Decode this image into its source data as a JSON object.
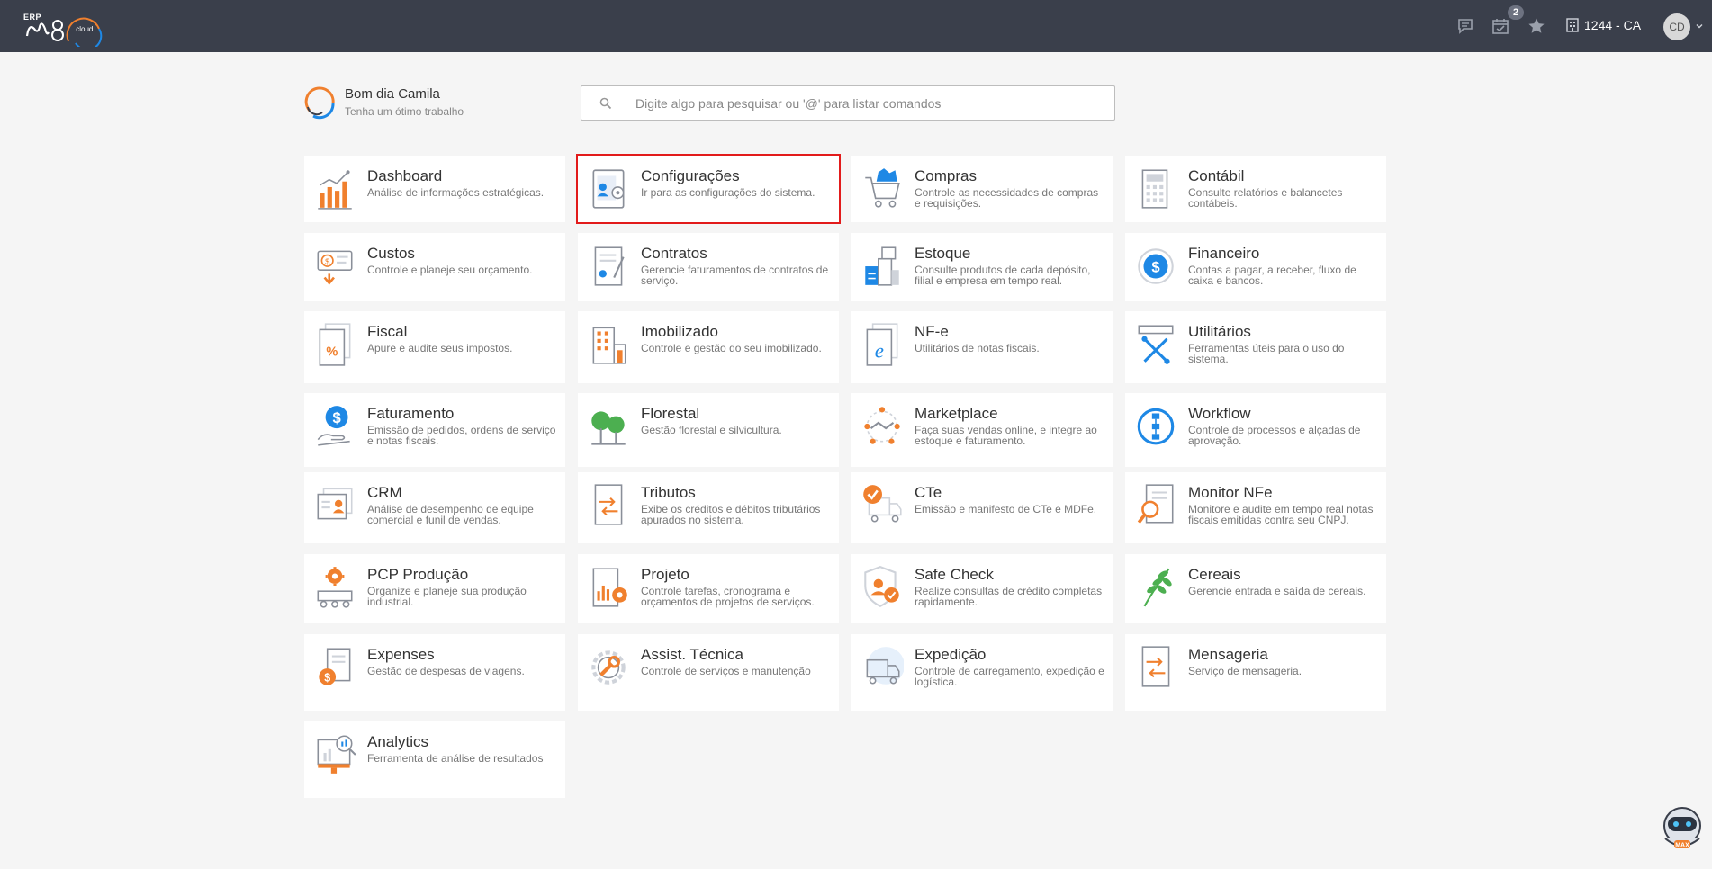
{
  "header": {
    "logo_small": "ERP",
    "notification_count": "2",
    "company": "1244 - CA",
    "avatar_initials": "CD"
  },
  "greeting": {
    "title": "Bom dia Camila",
    "subtitle": "Tenha um ótimo trabalho"
  },
  "search": {
    "placeholder": "Digite algo para pesquisar ou '@' para listar comandos"
  },
  "modules": [
    {
      "title": "Dashboard",
      "desc": "Análise de informações estratégicas.",
      "icon": "bar-chart-icon"
    },
    {
      "title": "Configurações",
      "desc": "Ir para as configurações do sistema.",
      "icon": "settings-tablet-icon"
    },
    {
      "title": "Compras",
      "desc": "Controle as necessidades de compras e requisições.",
      "icon": "shopping-cart-icon"
    },
    {
      "title": "Contábil",
      "desc": "Consulte relatórios e balancetes contábeis.",
      "icon": "calculator-icon"
    },
    {
      "title": "Custos",
      "desc": "Controle e planeje seu orçamento.",
      "icon": "money-bill-icon"
    },
    {
      "title": "Contratos",
      "desc": "Gerencie faturamentos de contratos de serviço.",
      "icon": "contract-icon"
    },
    {
      "title": "Estoque",
      "desc": "Consulte produtos de cada depósito, filial e empresa em tempo real.",
      "icon": "warehouse-icon"
    },
    {
      "title": "Financeiro",
      "desc": "Contas a pagar, a receber, fluxo de caixa e bancos.",
      "icon": "dollar-circle-icon"
    },
    {
      "title": "Fiscal",
      "desc": "Apure e audite seus impostos.",
      "icon": "percent-document-icon"
    },
    {
      "title": "Imobilizado",
      "desc": "Controle e gestão do seu imobilizado.",
      "icon": "building-icon"
    },
    {
      "title": "NF-e",
      "desc": "Utilitários de notas fiscais.",
      "icon": "e-document-icon"
    },
    {
      "title": "Utilitários",
      "desc": "Ferramentas úteis para o uso do sistema.",
      "icon": "tools-icon"
    },
    {
      "title": "Faturamento",
      "desc": "Emissão de pedidos, ordens de serviço e notas fiscais.",
      "icon": "hand-dollar-icon"
    },
    {
      "title": "Florestal",
      "desc": "Gestão florestal e silvicultura.",
      "icon": "trees-icon"
    },
    {
      "title": "Marketplace",
      "desc": "Faça suas vendas online, e integre ao estoque e faturamento.",
      "icon": "handshake-icon"
    },
    {
      "title": "Workflow",
      "desc": "Controle de processos e alçadas de aprovação.",
      "icon": "workflow-icon"
    },
    {
      "title": "CRM",
      "desc": "Análise de desempenho de equipe comercial e funil de vendas.",
      "icon": "contact-card-icon"
    },
    {
      "title": "Tributos",
      "desc": "Exibe os créditos e débitos tributários apurados no sistema.",
      "icon": "exchange-document-icon"
    },
    {
      "title": "CTe",
      "desc": "Emissão e manifesto de CTe e MDFe.",
      "icon": "truck-check-icon"
    },
    {
      "title": "Monitor NFe",
      "desc": "Monitore e audite em tempo real notas fiscais emitidas contra seu CNPJ.",
      "icon": "magnifier-document-icon"
    },
    {
      "title": "PCP Produção",
      "desc": "Organize e planeje sua produção industrial.",
      "icon": "production-gear-icon"
    },
    {
      "title": "Projeto",
      "desc": "Controle tarefas, cronograma e orçamentos de projetos de serviços.",
      "icon": "project-gear-icon"
    },
    {
      "title": "Safe Check",
      "desc": "Realize consultas de crédito completas rapidamente.",
      "icon": "shield-check-icon"
    },
    {
      "title": "Cereais",
      "desc": "Gerencie entrada e saída de cereais.",
      "icon": "wheat-icon"
    },
    {
      "title": "Expenses",
      "desc": "Gestão de despesas de viagens.",
      "icon": "expense-receipt-icon"
    },
    {
      "title": "Assist. Técnica",
      "desc": "Controle de serviços e manutenção",
      "icon": "wrench-gear-icon"
    },
    {
      "title": "Expedição",
      "desc": "Controle de carregamento, expedição e logística.",
      "icon": "delivery-truck-icon"
    },
    {
      "title": "Mensageria",
      "desc": "Serviço de mensageria.",
      "icon": "message-exchange-icon"
    },
    {
      "title": "Analytics",
      "desc": "Ferramenta de análise de resultados",
      "icon": "analytics-monitor-icon"
    }
  ],
  "selected_module": "Configurações",
  "colors": {
    "topbar": "#3a3f4b",
    "accent_orange": "#f0802e",
    "accent_blue": "#1e88e5",
    "selection": "#e21b1b"
  }
}
